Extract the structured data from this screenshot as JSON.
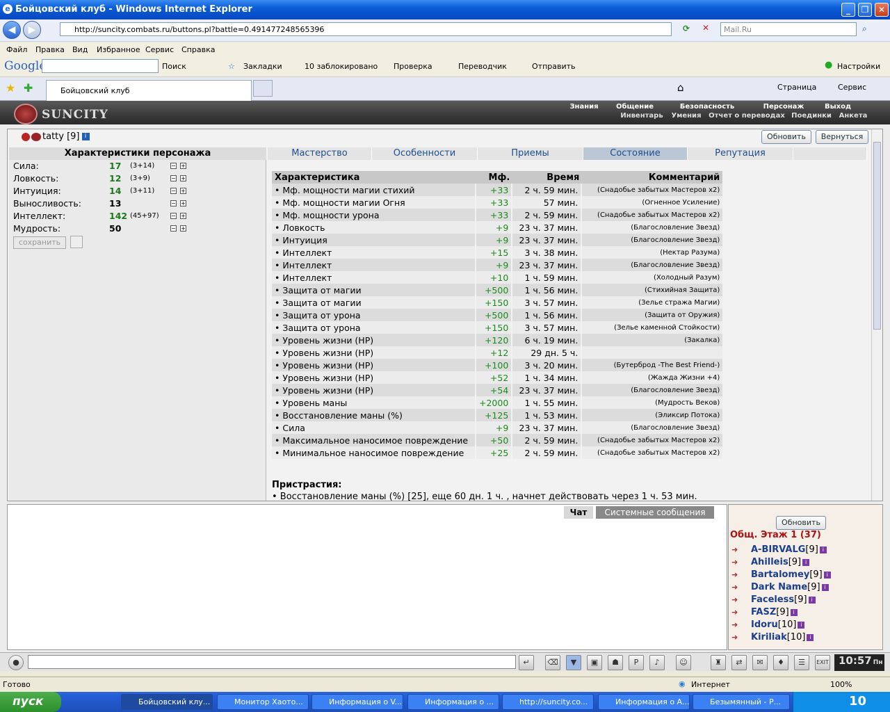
{
  "window": {
    "title": "Бойцовский клуб - Windows Internet Explorer",
    "url": "http://suncity.combats.ru/buttons.pl?battle=0.491477248565396",
    "search_placeholder": "Mail.Ru"
  },
  "menu": [
    "Файл",
    "Правка",
    "Вид",
    "Избранное",
    "Сервис",
    "Справка"
  ],
  "google_bar": {
    "logo": "Google",
    "search": "Поиск",
    "bookmarks": "Закладки",
    "blocked": "10 заблокировано",
    "check": "Проверка",
    "translator": "Переводчик",
    "send": "Отправить",
    "settings": "Настройки"
  },
  "tab": {
    "title": "Бойцовский клуб"
  },
  "cmdbar": {
    "page": "Страница",
    "service": "Сервис"
  },
  "site": {
    "logo": "SUNCITY",
    "topnav": [
      "Знания",
      "Общение",
      "Безопасность",
      "Персонаж",
      "Выход"
    ],
    "subnav": [
      "Инвентарь",
      "Умения",
      "Отчет о переводах",
      "Поединки",
      "Анкета"
    ]
  },
  "character": {
    "name": "tatty",
    "level": "[9]",
    "refresh": "Обновить",
    "back": "Вернуться"
  },
  "stats_panel": {
    "title": "Характеристики персонажа",
    "stats": [
      {
        "name": "Сила:",
        "value": "17",
        "bonus": "(3+14)"
      },
      {
        "name": "Ловкость:",
        "value": "12",
        "bonus": "(3+9)"
      },
      {
        "name": "Интуиция:",
        "value": "14",
        "bonus": "(3+11)"
      },
      {
        "name": "Выносливость:",
        "value": "13",
        "bonus": ""
      },
      {
        "name": "Интеллект:",
        "value": "142",
        "bonus": "(45+97)"
      },
      {
        "name": "Мудрость:",
        "value": "50",
        "bonus": ""
      }
    ],
    "save": "сохранить"
  },
  "tabs": [
    "Мастерство",
    "Особенности",
    "Приемы",
    "Состояние",
    "Репутация"
  ],
  "effects": {
    "headers": [
      "Характеристика",
      "Мф.",
      "Время",
      "Комментарий"
    ],
    "rows": [
      [
        "• Мф. мощности магии стихий",
        "+33",
        "2 ч. 59 мин.",
        "(Снадобье забытых Мастеров x2)"
      ],
      [
        "• Мф. мощности магии Огня",
        "+33",
        "57 мин.",
        "(Огненное Усиление)"
      ],
      [
        "• Мф. мощности урона",
        "+33",
        "2 ч. 59 мин.",
        "(Снадобье забытых Мастеров x2)"
      ],
      [
        "• Ловкость",
        "+9",
        "23 ч. 37 мин.",
        "(Благословление Звезд)"
      ],
      [
        "• Интуиция",
        "+9",
        "23 ч. 37 мин.",
        "(Благословление Звезд)"
      ],
      [
        "• Интеллект",
        "+15",
        "3 ч. 38 мин.",
        "(Нектар Разума)"
      ],
      [
        "• Интеллект",
        "+9",
        "23 ч. 37 мин.",
        "(Благословление Звезд)"
      ],
      [
        "• Интеллект",
        "+10",
        "1 ч. 59 мин.",
        "(Холодный Разум)"
      ],
      [
        "• Защита от магии",
        "+500",
        "1 ч. 56 мин.",
        "(Стихийная Защита)"
      ],
      [
        "• Защита от магии",
        "+150",
        "3 ч. 57 мин.",
        "(Зелье стража Магии)"
      ],
      [
        "• Защита от урона",
        "+500",
        "1 ч. 56 мин.",
        "(Защита от Оружия)"
      ],
      [
        "• Защита от урона",
        "+150",
        "3 ч. 57 мин.",
        "(Зелье каменной Стойкости)"
      ],
      [
        "• Уровень жизни (HP)",
        "+120",
        "6 ч. 19 мин.",
        "(Закалка)"
      ],
      [
        "• Уровень жизни (HP)",
        "+12",
        "29 дн. 5 ч.",
        ""
      ],
      [
        "• Уровень жизни (HP)",
        "+100",
        "3 ч. 20 мин.",
        "(Бутерброд -The Best Friend-)"
      ],
      [
        "• Уровень жизни (HP)",
        "+52",
        "1 ч. 34 мин.",
        "(Жажда Жизни +4)"
      ],
      [
        "• Уровень жизни (HP)",
        "+54",
        "23 ч. 37 мин.",
        "(Благословление Звезд)"
      ],
      [
        "• Уровень маны",
        "+2000",
        "1 ч. 55 мин.",
        "(Мудрость Веков)"
      ],
      [
        "• Восстановление маны (%)",
        "+125",
        "1 ч. 53 мин.",
        "(Эликсир Потока)"
      ],
      [
        "• Сила",
        "+9",
        "23 ч. 37 мин.",
        "(Благословление Звезд)"
      ],
      [
        "• Максимальное наносимое повреждение",
        "+50",
        "2 ч. 59 мин.",
        "(Снадобье забытых Мастеров x2)"
      ],
      [
        "• Минимальное наносимое повреждение",
        "+25",
        "2 ч. 59 мин.",
        "(Снадобье забытых Мастеров x2)"
      ]
    ]
  },
  "addictions": {
    "title": "Пристрастия:",
    "line": "• Восстановление маны (%) [25], еще 60 дн. 1 ч. , начнет действовать через 1 ч. 53 мин."
  },
  "chat": {
    "tab_chat": "Чат",
    "tab_system": "Системные сообщения"
  },
  "online": {
    "refresh": "Обновить",
    "title": "Общ. Этаж 1 (37)",
    "users": [
      {
        "name": "A-BIRVALG",
        "level": "[9]"
      },
      {
        "name": "Ahilleis",
        "level": "[9]"
      },
      {
        "name": "Bartalomey",
        "level": "[9]"
      },
      {
        "name": "Dark Name",
        "level": "[9]"
      },
      {
        "name": "Faceless",
        "level": "[9]"
      },
      {
        "name": "FASZ",
        "level": "[9]"
      },
      {
        "name": "Idoru",
        "level": "[10]"
      },
      {
        "name": "Kiriliak",
        "level": "[10]"
      }
    ]
  },
  "clock": {
    "time": "10:57",
    "day": "Пн"
  },
  "status": {
    "left": "Готово",
    "zone": "Интернет",
    "zoom": "100%"
  },
  "taskbar": {
    "start": "пуск",
    "tasks": [
      "Бойцовский клу...",
      "Монитор Хаото...",
      "Информация о V...",
      "Информация о ...",
      "http://suncity.co...",
      "Информация о А...",
      "Безымянный - Р..."
    ],
    "time": "10"
  }
}
